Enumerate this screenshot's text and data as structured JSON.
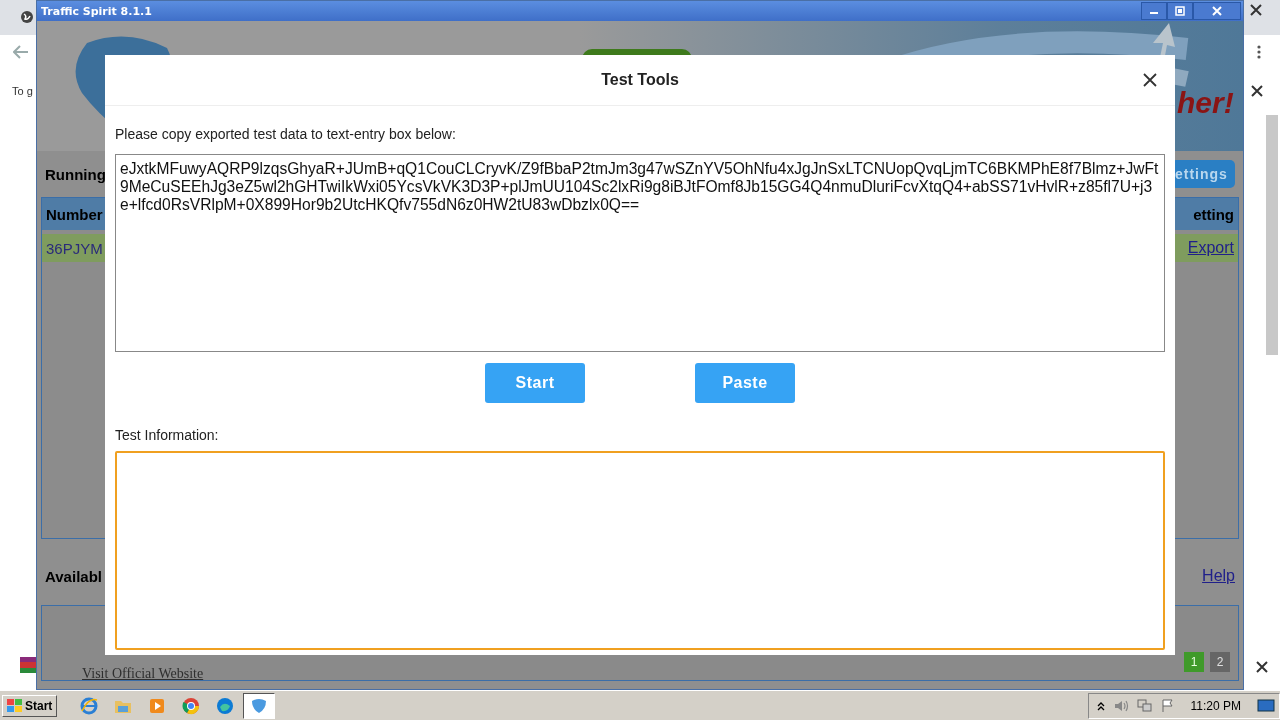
{
  "browser": {
    "notice_text": "To g"
  },
  "app_window": {
    "title": "Traffic Spirit 8.1.1",
    "banner_slogan": "her!",
    "running_heading": "Running",
    "settings_button": "ettings",
    "table": {
      "columns": [
        "Number",
        "etting"
      ],
      "rows": [
        {
          "number": "36PJYM",
          "action": "Export"
        }
      ]
    },
    "available_heading": "Availabl",
    "help_link": "Help",
    "footer_link": "Visit Official Website",
    "pages": [
      {
        "label": "1",
        "selected": true
      },
      {
        "label": "2",
        "selected": false
      }
    ]
  },
  "dialog": {
    "title": "Test Tools",
    "data_label": "Please copy exported test data to text-entry box below:",
    "data_value": "eJxtkMFuwyAQRP9lzqsGhyaR+JUmB+qQ1CouCLCryvK/Z9fBbaP2tmJm3g47wSZnYV5OhNfu4xJgJnSxLTCNUopQvqLjmTC6BKMPhE8f7Blmz+JwFt9MeCuSEEhJg3eZ5wl2hGHTwiIkWxi05YcsVkVK3D3P+plJmUU104Sc2lxRi9g8iBJtFOmf8Jb15GG4Q4nmuDluriFcvXtqQ4+abSS71vHvlR+z85fl7U+j3e+lfcd0RsVRlpM+0X899Hor9b2UtcHKQfv755dN6z0HW2tU83wDbzlx0Q==",
    "buttons": [
      "Start",
      "Paste"
    ],
    "info_label": "Test Information:",
    "info_focused": true
  },
  "taskbar": {
    "start": "Start",
    "clock": "11:20 PM",
    "apps": [
      {
        "kind": "ie",
        "selected": false
      },
      {
        "kind": "folder",
        "selected": false
      },
      {
        "kind": "player",
        "selected": false
      },
      {
        "kind": "chrome",
        "selected": false
      },
      {
        "kind": "edge",
        "selected": false
      },
      {
        "kind": "shield",
        "selected": true
      }
    ]
  }
}
